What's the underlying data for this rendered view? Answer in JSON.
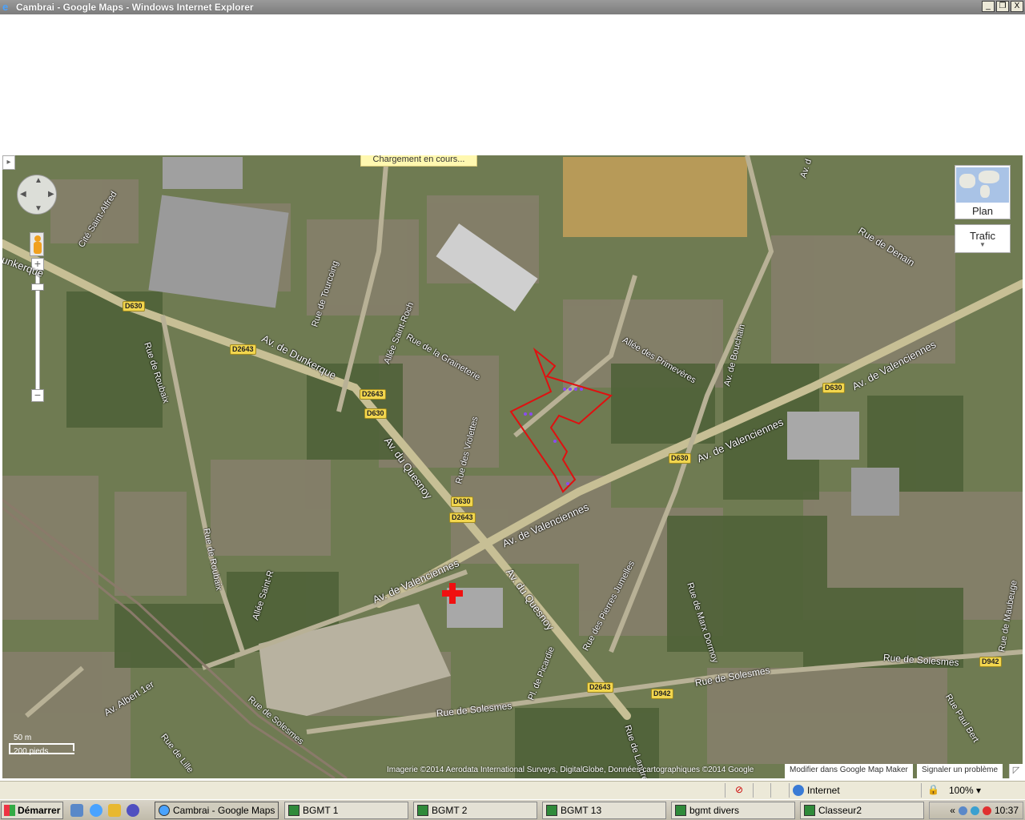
{
  "window": {
    "title": "Cambrai - Google Maps - Windows Internet Explorer",
    "controls": {
      "minimize": "_",
      "restore": "❐",
      "close": "X"
    }
  },
  "map": {
    "loading_text": "Chargement en cours...",
    "collapse_arrow": "▸",
    "zoom_in": "+",
    "zoom_out": "−",
    "map_type_label": "Plan",
    "traffic_label": "Trafic",
    "traffic_chevron": "▼",
    "scale_metric": "50 m",
    "scale_imperial": "200 pieds",
    "attribution": "Imagerie ©2014 Aerodata International Surveys, DigitalGlobe, Données cartographiques ©2014 Google",
    "mapmaker_button": "Modifier dans Google Map Maker",
    "report_button": "Signaler un problème",
    "expand_icon": "◸",
    "roads": [
      "unkerque",
      "Cité Saint-Alfred",
      "Av. de Dunkerque",
      "Rue de Roubaix",
      "Rue de Tourcoing",
      "Allée Saint-Roch",
      "Rue de la Graineterie",
      "Rue des Violettes",
      "Allée des Primevères",
      "Av. de Bouchain",
      "Rue de Denain",
      "Av. de Valenciennes",
      "Av. du Quesnoy",
      "Rue de Marx Dormoy",
      "Rue des Pierres Jumelles",
      "Rue de Maubeuge",
      "Rue de Solesmes",
      "Rue Paul Bert",
      "Pl. de Picardie",
      "Av. Albert 1er",
      "Rue de Lille",
      "Rue de Landrecies",
      "Allée Saint-R",
      "Av. d"
    ],
    "shields": [
      "D630",
      "D2643",
      "D942"
    ]
  },
  "statusbar": {
    "zone": "Internet",
    "zoom": "100%"
  },
  "taskbar": {
    "start": "Démarrer",
    "tasks": [
      "Cambrai - Google Maps -...",
      "BGMT 1",
      "BGMT 2",
      "BGMT 13",
      "bgmt divers",
      "Classeur2"
    ],
    "clock": "10:37",
    "tray_chevron": "«"
  }
}
